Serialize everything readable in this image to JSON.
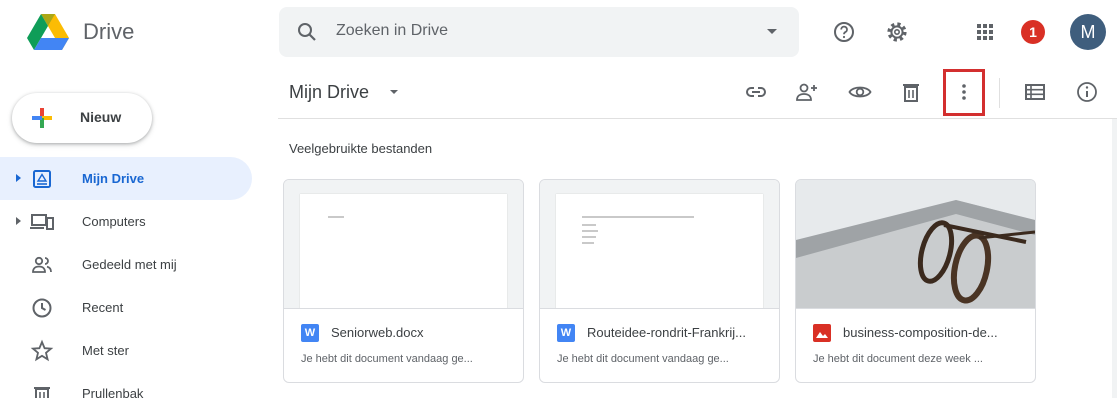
{
  "app": {
    "name": "Drive"
  },
  "search": {
    "placeholder": "Zoeken in Drive"
  },
  "header": {
    "notification_count": "1",
    "avatar_letter": "M"
  },
  "new_button": {
    "label": "Nieuw"
  },
  "sidebar": {
    "items": [
      {
        "label": "Mijn Drive",
        "icon": "drive-folder-icon",
        "active": true
      },
      {
        "label": "Computers",
        "icon": "computer-icon"
      },
      {
        "label": "Gedeeld met mij",
        "icon": "people-icon"
      },
      {
        "label": "Recent",
        "icon": "clock-icon"
      },
      {
        "label": "Met ster",
        "icon": "star-icon"
      },
      {
        "label": "Prullenbak",
        "icon": "trash-icon"
      }
    ]
  },
  "main": {
    "breadcrumb": "Mijn Drive",
    "section_title": "Veelgebruikte bestanden",
    "files": [
      {
        "name": "Seniorweb.docx",
        "subtitle": "Je hebt dit document vandaag ge...",
        "type": "W",
        "type_color": "#4285f4"
      },
      {
        "name": "Routeidee-rondrit-Frankrij...",
        "subtitle": "Je hebt dit document vandaag ge...",
        "type": "W",
        "type_color": "#4285f4"
      },
      {
        "name": "business-composition-de...",
        "subtitle": "Je hebt dit document deze week ...",
        "type": "image",
        "type_color": "#d93025"
      }
    ]
  },
  "colors": {
    "accent": "#1967d2",
    "active_bg": "#e8f0fe",
    "highlight": "#d32f2f",
    "avatar": "#3f5e7d",
    "badge": "#d93025"
  }
}
